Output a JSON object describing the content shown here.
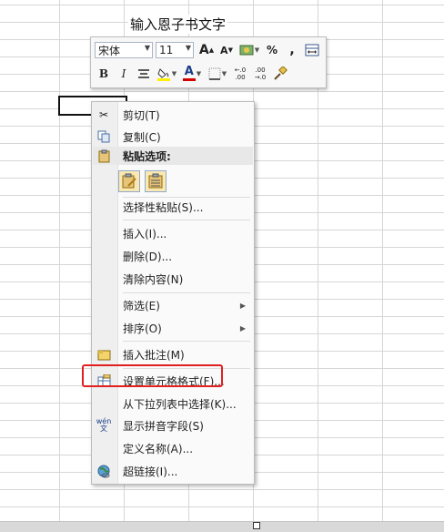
{
  "sheet": {
    "cell_text": "输入恩子书文字"
  },
  "mini_toolbar": {
    "font_name": "宋体",
    "font_size": "11",
    "grow_font": "A",
    "shrink_font": "A",
    "percent": "%",
    "comma": ",",
    "bold": "B",
    "italic": "I",
    "font_color": "A",
    "inc_decimal_top": "←.0",
    "inc_decimal_bot": ".00",
    "dec_decimal_top": ".00",
    "dec_decimal_bot": "→.0",
    "font_color_hex": "#d40000",
    "highlight_hex": "#ffef00"
  },
  "context_menu": {
    "cut": "剪切(T)",
    "copy": "复制(C)",
    "paste_options": "粘贴选项:",
    "paste_special": "选择性粘贴(S)...",
    "insert": "插入(I)...",
    "delete": "删除(D)...",
    "clear": "清除内容(N)",
    "filter": "筛选(E)",
    "sort": "排序(O)",
    "insert_comment": "插入批注(M)",
    "format_cells": "设置单元格格式(F)...",
    "pick_list": "从下拉列表中选择(K)...",
    "phonetic": "显示拼音字段(S)",
    "define_name": "定义名称(A)...",
    "hyperlink": "超链接(I)...",
    "phonetic_icon_text": "wén\n文",
    "highlight_color": "#e02020"
  }
}
